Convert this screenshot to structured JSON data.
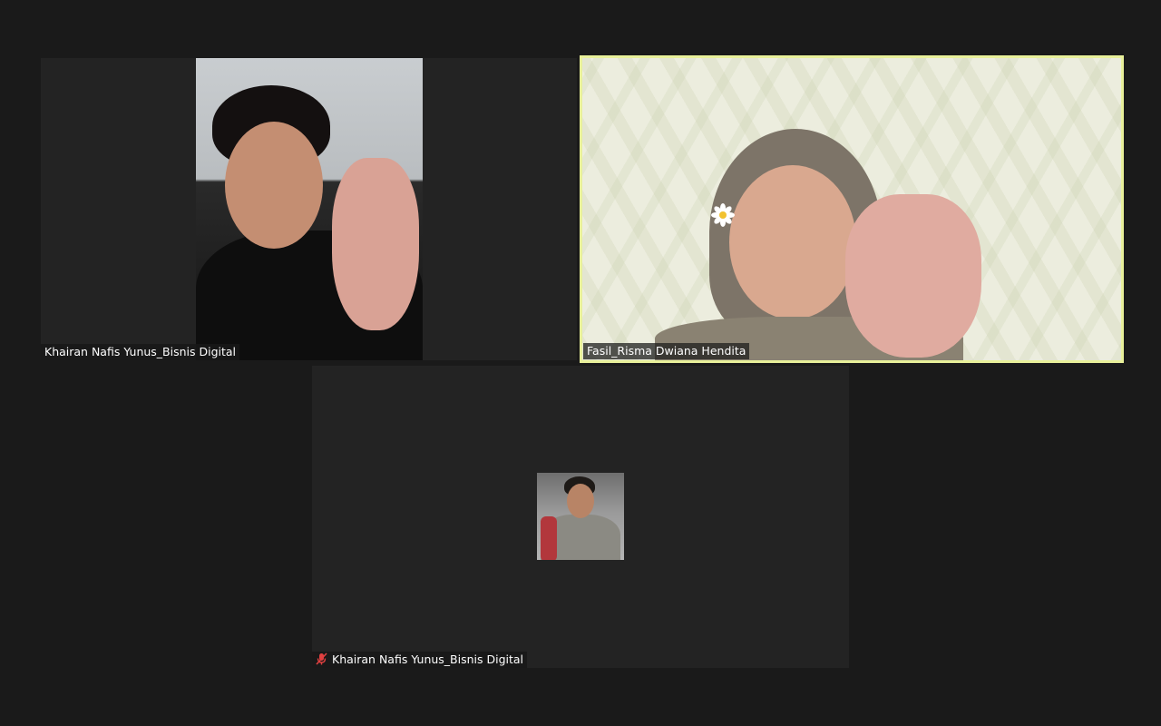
{
  "participants": [
    {
      "name": "Khairan Nafis Yunus_Bisnis Digital",
      "muted": false,
      "active_speaker": false
    },
    {
      "name": "Fasil_Risma Dwiana Hendita",
      "muted": false,
      "active_speaker": true
    },
    {
      "name": "Khairan Nafis Yunus_Bisnis Digital",
      "muted": true,
      "active_speaker": false
    }
  ],
  "icons": {
    "muted": "microphone-muted-icon",
    "reaction": "flower-icon"
  },
  "colors": {
    "background": "#1a1a1a",
    "tile": "#232323",
    "active_speaker_border": "#e8f09a",
    "muted_icon": "#e04040"
  }
}
